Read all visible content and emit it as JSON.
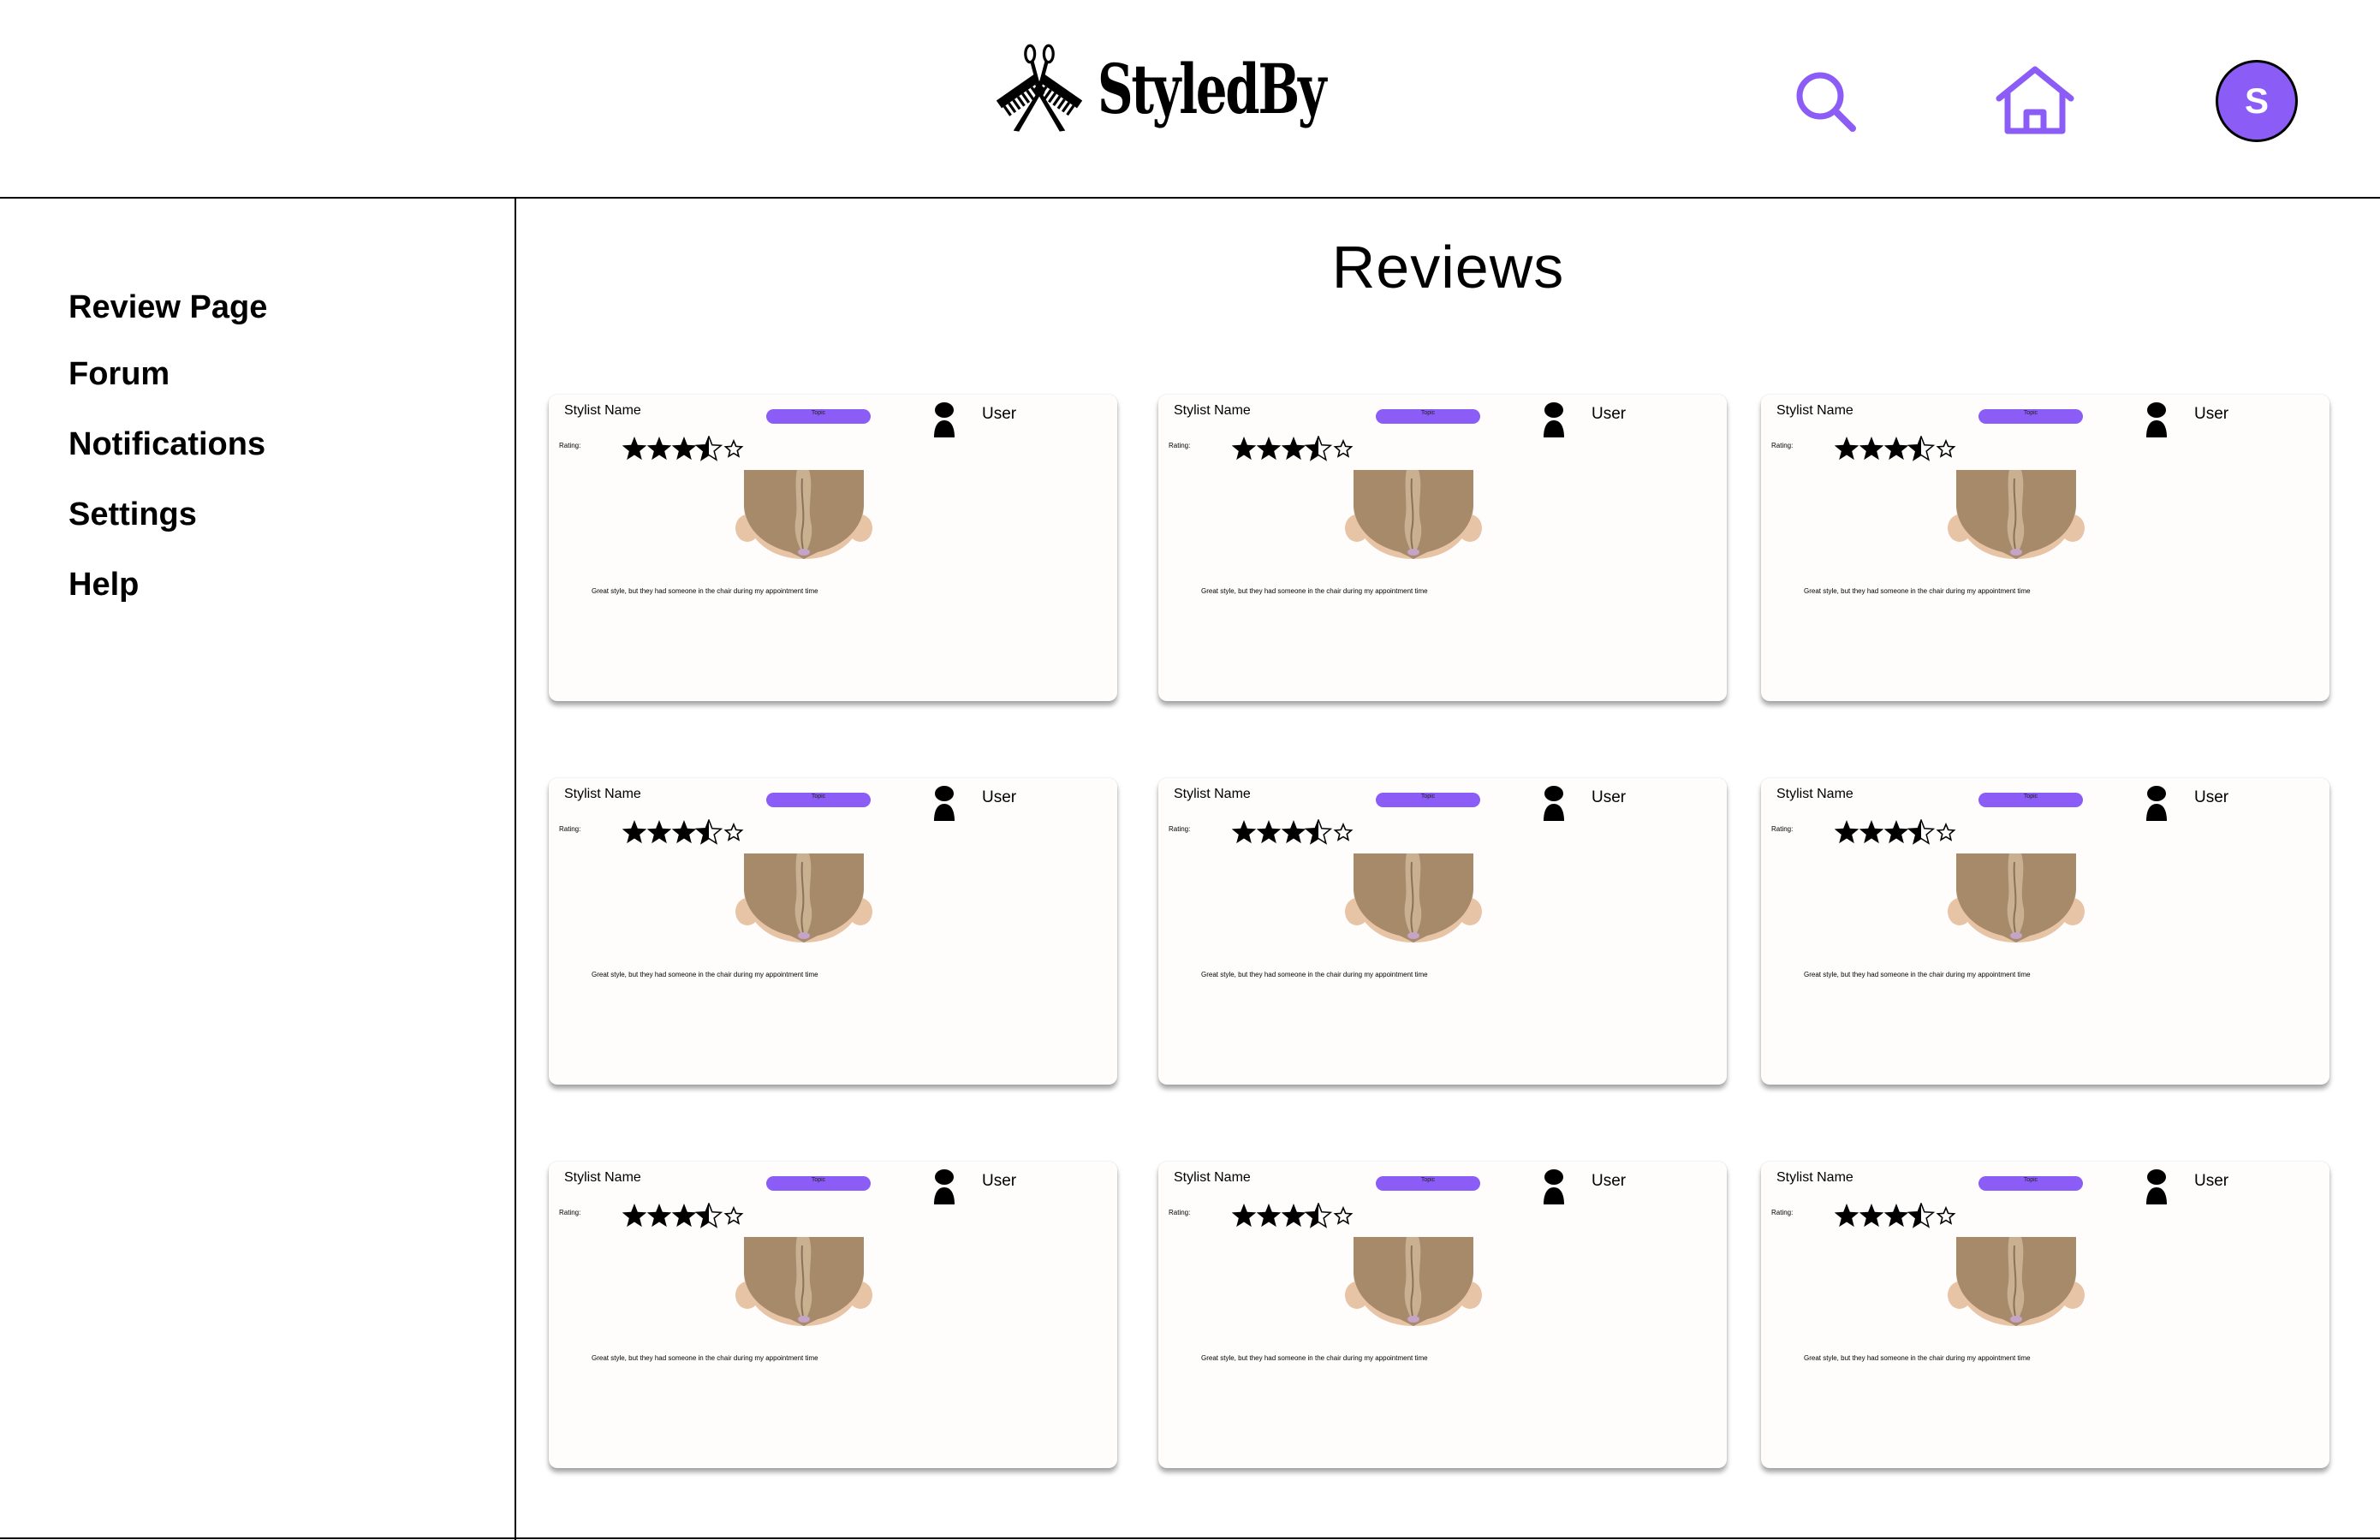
{
  "header": {
    "brand": "StyledBy",
    "icons": {
      "logo": "comb-scissors-logo-icon",
      "search": "search-icon",
      "home": "home-icon"
    },
    "avatar_initial": "S",
    "accent_color": "#8b5cf6"
  },
  "sidebar": {
    "items": [
      {
        "label": "Review Page"
      },
      {
        "label": "Forum"
      },
      {
        "label": "Notifications"
      },
      {
        "label": "Settings"
      },
      {
        "label": "Help"
      }
    ]
  },
  "main": {
    "title": "Reviews",
    "reviews": [
      {
        "stylist": "Stylist Name",
        "topic": "Topic",
        "user": "User",
        "rating_label": "Rating:",
        "rating": 3.5,
        "text": "Great style, but they had someone in the chair during my appointment time"
      },
      {
        "stylist": "Stylist Name",
        "topic": "Topic",
        "user": "User",
        "rating_label": "Rating:",
        "rating": 3.5,
        "text": "Great style, but they had someone in the chair during my appointment time"
      },
      {
        "stylist": "Stylist Name",
        "topic": "Topic",
        "user": "User",
        "rating_label": "Rating:",
        "rating": 3.5,
        "text": "Great style, but they had someone in the chair during my appointment time"
      },
      {
        "stylist": "Stylist Name",
        "topic": "Topic",
        "user": "User",
        "rating_label": "Rating:",
        "rating": 3.5,
        "text": "Great style, but they had someone in the chair during my appointment time"
      },
      {
        "stylist": "Stylist Name",
        "topic": "Topic",
        "user": "User",
        "rating_label": "Rating:",
        "rating": 3.5,
        "text": "Great style, but they had someone in the chair during my appointment time"
      },
      {
        "stylist": "Stylist Name",
        "topic": "Topic",
        "user": "User",
        "rating_label": "Rating:",
        "rating": 3.5,
        "text": "Great style, but they had someone in the chair during my appointment time"
      },
      {
        "stylist": "Stylist Name",
        "topic": "Topic",
        "user": "User",
        "rating_label": "Rating:",
        "rating": 3.5,
        "text": "Great style, but they had someone in the chair during my appointment time"
      },
      {
        "stylist": "Stylist Name",
        "topic": "Topic",
        "user": "User",
        "rating_label": "Rating:",
        "rating": 3.5,
        "text": "Great style, but they had someone in the chair during my appointment time"
      },
      {
        "stylist": "Stylist Name",
        "topic": "Topic",
        "user": "User",
        "rating_label": "Rating:",
        "rating": 3.5,
        "text": "Great style, but they had someone in the chair during my appointment time"
      }
    ]
  }
}
